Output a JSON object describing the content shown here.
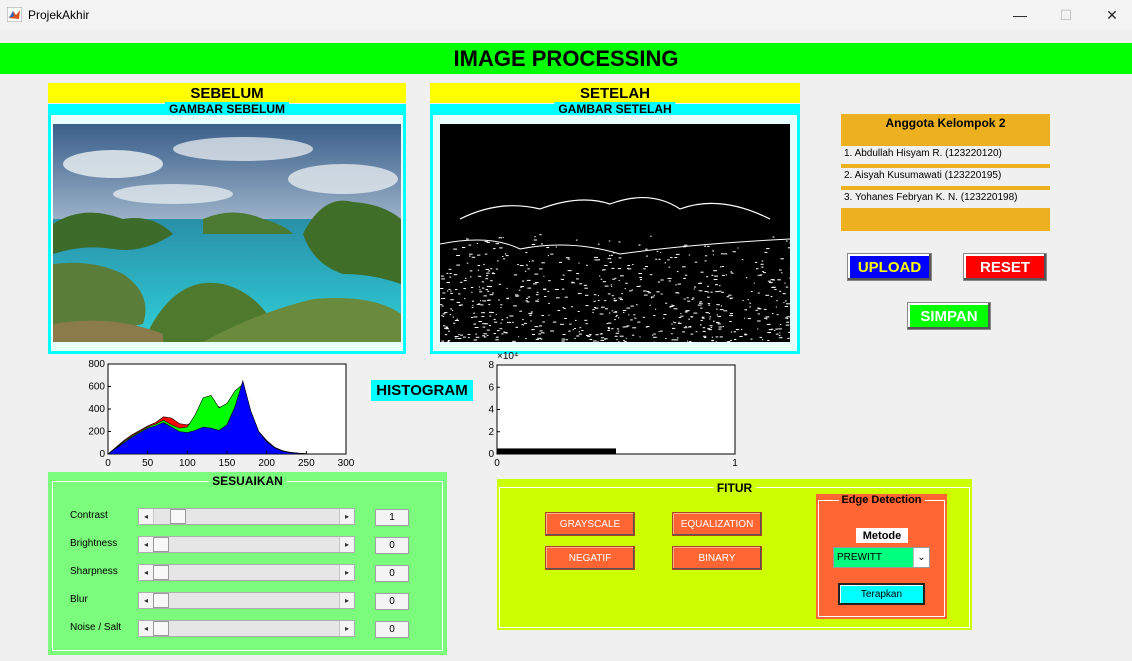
{
  "window": {
    "title": "ProjekAkhir",
    "minimize_icon": "minimize-icon",
    "maximize_icon": "maximize-icon",
    "close_icon": "close-icon"
  },
  "banner": {
    "title": "IMAGE PROCESSING",
    "color": "#00ff00"
  },
  "before": {
    "label": "SEBELUM",
    "panel_title": "GAMBAR SEBELUM"
  },
  "after": {
    "label": "SETELAH",
    "panel_title": "GAMBAR SETELAH"
  },
  "team": {
    "title": "Anggota Kelompok 2",
    "members": [
      "1. Abdullah Hisyam R. (123220120)",
      "2. Aisyah Kusumawati (123220195)",
      "3. Yohanes Febryan K. N. (123220198)"
    ]
  },
  "actions": {
    "upload": "UPLOAD",
    "reset": "RESET",
    "simpan": "SIMPAN"
  },
  "histogram_label": "HISTOGRAM",
  "adjust": {
    "title": "SESUAIKAN",
    "sliders": [
      {
        "label": "Contrast",
        "value": "1",
        "level": 0.1
      },
      {
        "label": "Brightness",
        "value": "0",
        "level": 0
      },
      {
        "label": "Sharpness",
        "value": "0",
        "level": 0
      },
      {
        "label": "Blur",
        "value": "0",
        "level": 0
      },
      {
        "label": "Noise / Salt",
        "value": "0",
        "level": 0
      }
    ]
  },
  "fitur": {
    "title": "FITUR",
    "buttons": [
      "GRAYSCALE",
      "EQUALIZATION",
      "NEGATIF",
      "BINARY"
    ],
    "edge": {
      "title": "Edge Detection",
      "metode_label": "Metode",
      "selected": "PREWITT",
      "apply": "Terapkan"
    }
  },
  "chart_data": [
    {
      "type": "area",
      "x_ticks": [
        "0",
        "50",
        "100",
        "150",
        "200",
        "250",
        "300"
      ],
      "y_ticks": [
        "0",
        "200",
        "400",
        "600",
        "800"
      ],
      "xlim": [
        0,
        300
      ],
      "ylim": [
        0,
        800
      ],
      "series": [
        {
          "color": "#ff0000",
          "x": [
            0,
            10,
            20,
            30,
            40,
            50,
            60,
            70,
            80,
            90,
            100,
            110,
            120,
            130,
            140,
            150,
            160,
            170,
            180,
            190,
            200,
            210,
            220,
            230,
            240,
            250,
            255
          ],
          "y": [
            0,
            60,
            120,
            170,
            210,
            250,
            280,
            330,
            320,
            270,
            260,
            300,
            420,
            440,
            420,
            390,
            470,
            640,
            380,
            200,
            120,
            60,
            30,
            15,
            8,
            3,
            0
          ]
        },
        {
          "color": "#00ff00",
          "x": [
            0,
            10,
            20,
            30,
            40,
            50,
            60,
            70,
            80,
            90,
            100,
            110,
            120,
            130,
            140,
            150,
            160,
            170,
            180,
            190,
            200,
            210,
            220,
            230,
            240,
            250,
            255
          ],
          "y": [
            0,
            55,
            110,
            160,
            200,
            240,
            265,
            300,
            260,
            230,
            240,
            350,
            500,
            520,
            410,
            450,
            560,
            620,
            360,
            190,
            110,
            55,
            25,
            12,
            6,
            2,
            0
          ]
        },
        {
          "color": "#0000ff",
          "x": [
            0,
            10,
            20,
            30,
            40,
            50,
            60,
            70,
            80,
            90,
            100,
            110,
            120,
            130,
            140,
            150,
            160,
            170,
            180,
            190,
            200,
            210,
            220,
            230,
            240,
            250,
            255
          ],
          "y": [
            0,
            50,
            100,
            150,
            190,
            230,
            250,
            280,
            240,
            200,
            190,
            210,
            240,
            230,
            210,
            260,
            420,
            650,
            380,
            200,
            110,
            55,
            25,
            12,
            6,
            2,
            0
          ]
        }
      ]
    },
    {
      "type": "bar",
      "y_unit": "×10⁴",
      "x_ticks": [
        "0",
        "1"
      ],
      "y_ticks": [
        "0",
        "2",
        "4",
        "6",
        "8"
      ],
      "xlim": [
        0,
        1
      ],
      "ylim": [
        0,
        8
      ],
      "x": [
        0.25
      ],
      "values": [
        0.5
      ]
    }
  ]
}
